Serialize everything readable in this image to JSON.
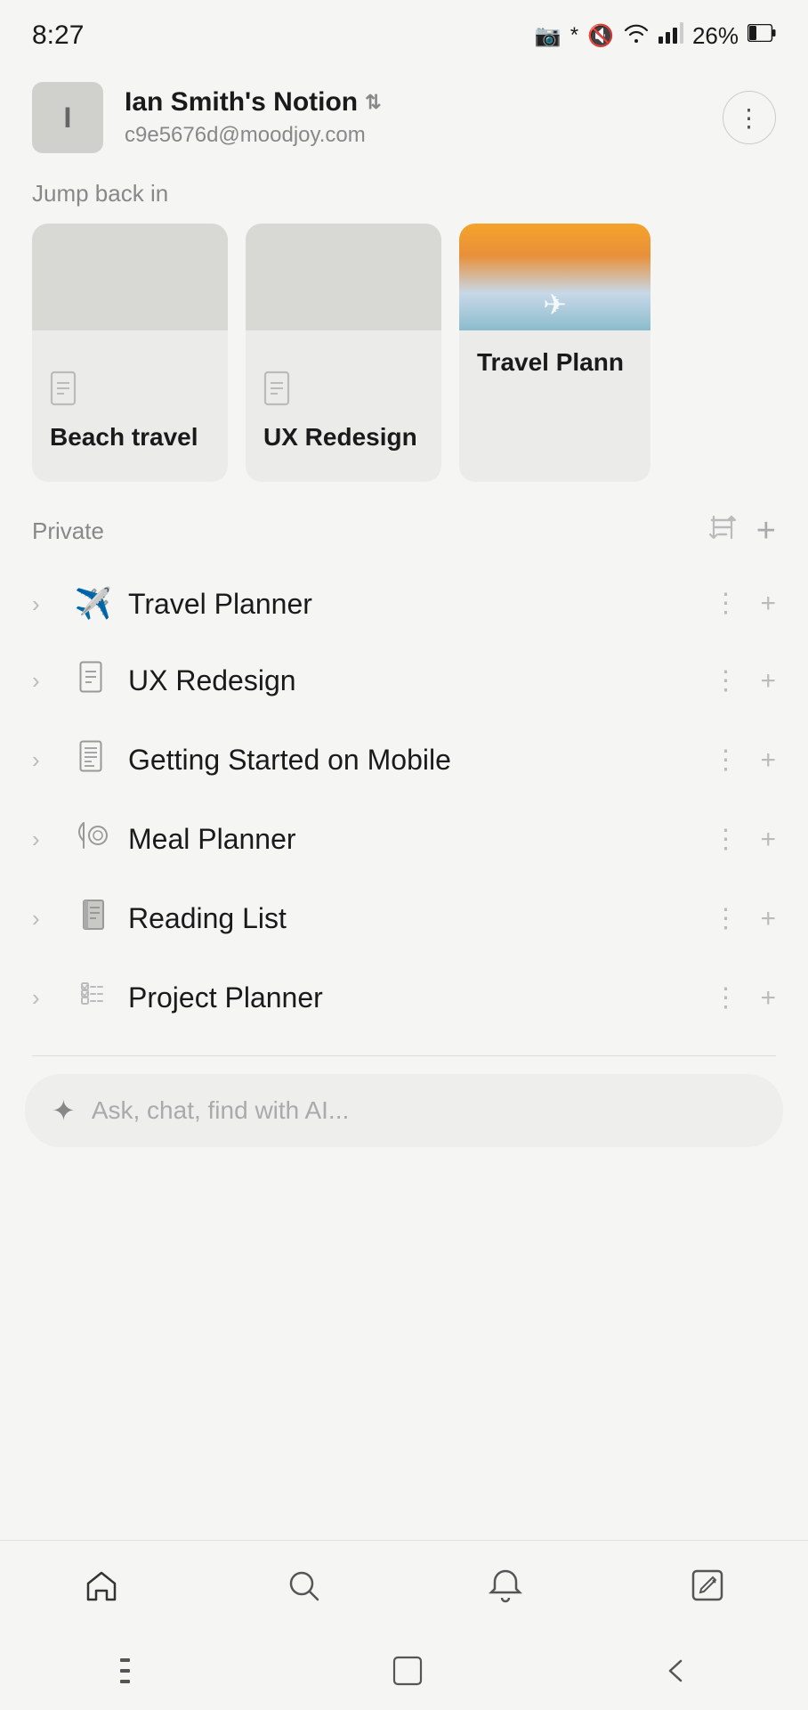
{
  "statusBar": {
    "time": "8:27",
    "icons": "📷 ⚡ 🔇 📶 📶 26% 🔋"
  },
  "account": {
    "initial": "I",
    "name": "Ian Smith's Notion",
    "email": "c9e5676d@moodjoy.com",
    "moreLabel": "⋮"
  },
  "jumpBackIn": {
    "label": "Jump back in",
    "cards": [
      {
        "title": "Beach travel",
        "hasImage": false
      },
      {
        "title": "UX Redesign",
        "hasImage": false
      },
      {
        "title": "Travel Plann",
        "hasImage": true
      }
    ]
  },
  "private": {
    "label": "Private",
    "sortIcon": "⇅",
    "addIcon": "+"
  },
  "navItems": [
    {
      "icon": "✈️",
      "title": "Travel Planner"
    },
    {
      "icon": "📄",
      "title": "UX Redesign"
    },
    {
      "icon": "📋",
      "title": "Getting Started on Mobile"
    },
    {
      "icon": "🍽️",
      "title": "Meal Planner"
    },
    {
      "icon": "📕",
      "title": "Reading List"
    },
    {
      "icon": "☑️",
      "title": "Project Planner"
    }
  ],
  "aiInput": {
    "placeholder": "Ask, chat, find with AI...",
    "starIcon": "✦"
  },
  "bottomNav": [
    {
      "icon": "🏠",
      "name": "home"
    },
    {
      "icon": "🔍",
      "name": "search"
    },
    {
      "icon": "🔔",
      "name": "notifications"
    },
    {
      "icon": "✏️",
      "name": "edit"
    }
  ],
  "androidNav": [
    {
      "icon": "☰",
      "name": "menu"
    },
    {
      "icon": "⬜",
      "name": "home"
    },
    {
      "icon": "‹",
      "name": "back"
    }
  ]
}
